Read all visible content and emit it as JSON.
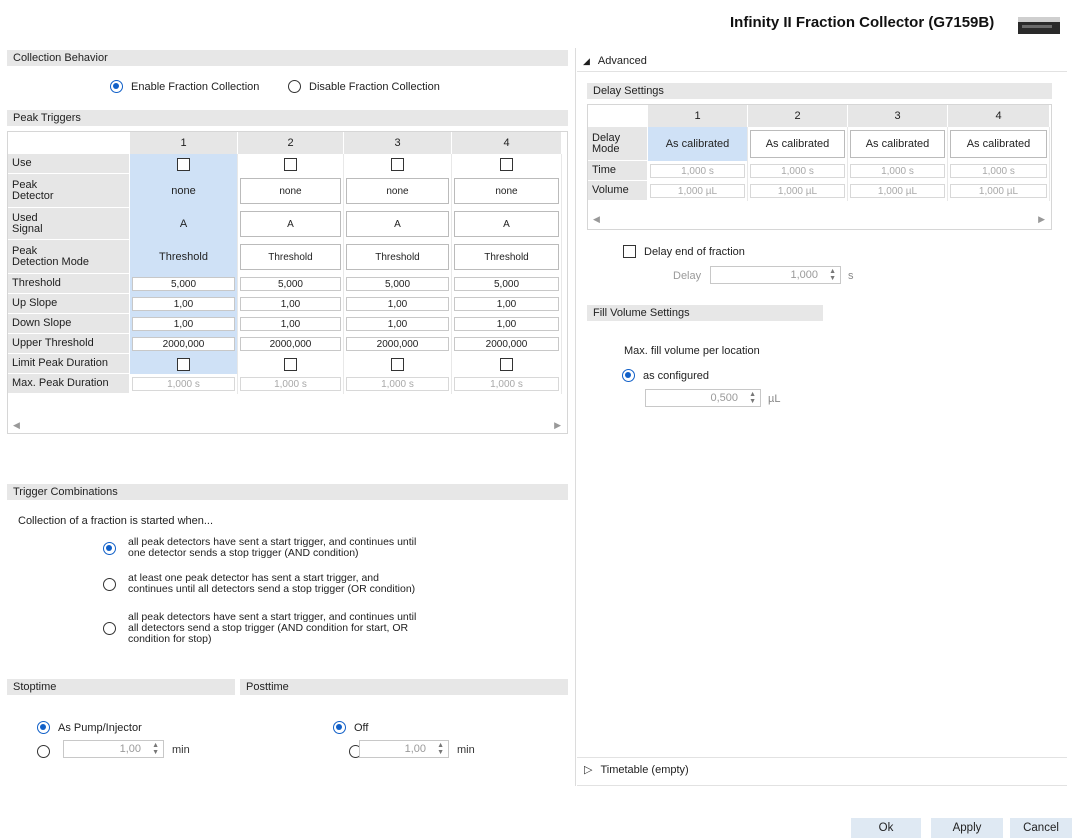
{
  "header": {
    "title": "Infinity II Fraction Collector (G7159B)"
  },
  "collection_behavior": {
    "title": "Collection Behavior",
    "enable_label": "Enable Fraction Collection",
    "disable_label": "Disable Fraction Collection"
  },
  "peak_triggers": {
    "title": "Peak Triggers",
    "columns": [
      "1",
      "2",
      "3",
      "4"
    ],
    "rows": {
      "use": "Use",
      "peak_detector": "Peak\nDetector",
      "used_signal": "Used\nSignal",
      "detection_mode": "Peak\nDetection Mode",
      "threshold": "Threshold",
      "up_slope": "Up Slope",
      "down_slope": "Down Slope",
      "upper_threshold": "Upper Threshold",
      "limit_peak_duration": "Limit Peak Duration",
      "max_peak_duration": "Max. Peak Duration"
    },
    "values": {
      "peak_detector": [
        "none",
        "none",
        "none",
        "none"
      ],
      "used_signal": [
        "A",
        "A",
        "A",
        "A"
      ],
      "detection_mode": [
        "Threshold",
        "Threshold",
        "Threshold",
        "Threshold"
      ],
      "threshold": [
        "5,000",
        "5,000",
        "5,000",
        "5,000"
      ],
      "up_slope": [
        "1,00",
        "1,00",
        "1,00",
        "1,00"
      ],
      "down_slope": [
        "1,00",
        "1,00",
        "1,00",
        "1,00"
      ],
      "upper_threshold": [
        "2000,000",
        "2000,000",
        "2000,000",
        "2000,000"
      ],
      "max_peak_duration": [
        "1,000 s",
        "1,000 s",
        "1,000 s",
        "1,000 s"
      ]
    }
  },
  "trigger_combinations": {
    "title": "Trigger Combinations",
    "intro": "Collection of a fraction is started when...",
    "options": [
      "all peak detectors have sent a start trigger, and continues until\none detector sends a stop trigger (AND condition)",
      "at least one peak detector has sent a start trigger, and\ncontinues until all detectors send a stop trigger (OR condition)",
      "all peak detectors have sent a start trigger, and continues until\nall detectors send a stop trigger (AND condition for start, OR\ncondition for stop)"
    ]
  },
  "stoptime": {
    "title": "Stoptime",
    "option_label": "As Pump/Injector",
    "value": "1,00",
    "unit": "min"
  },
  "posttime": {
    "title": "Posttime",
    "option_label": "Off",
    "value": "1,00",
    "unit": "min"
  },
  "advanced": {
    "title": "Advanced",
    "delay_settings": {
      "title": "Delay Settings",
      "columns": [
        "1",
        "2",
        "3",
        "4"
      ],
      "rows": {
        "delay_mode": "Delay\nMode",
        "time": "Time",
        "volume": "Volume"
      },
      "values": {
        "delay_mode": [
          "As calibrated",
          "As calibrated",
          "As calibrated",
          "As calibrated"
        ],
        "time": [
          "1,000 s",
          "1,000 s",
          "1,000 s",
          "1,000 s"
        ],
        "volume": [
          "1,000 µL",
          "1,000 µL",
          "1,000 µL",
          "1,000 µL"
        ]
      }
    },
    "delay_end": {
      "label": "Delay end of fraction",
      "delay_label": "Delay",
      "value": "1,000",
      "unit": "s"
    },
    "fill_volume": {
      "title": "Fill Volume Settings",
      "max_label": "Max. fill volume per location",
      "as_configured_label": "as configured",
      "value": "0,500",
      "unit": "µL"
    }
  },
  "timetable": {
    "title": "Timetable (empty)"
  },
  "buttons": {
    "ok": "Ok",
    "apply": "Apply",
    "cancel": "Cancel"
  },
  "colors": {
    "accent": "#1160c8",
    "selected_cell": "#cfe1f6",
    "section_header": "#e7e7e7"
  }
}
